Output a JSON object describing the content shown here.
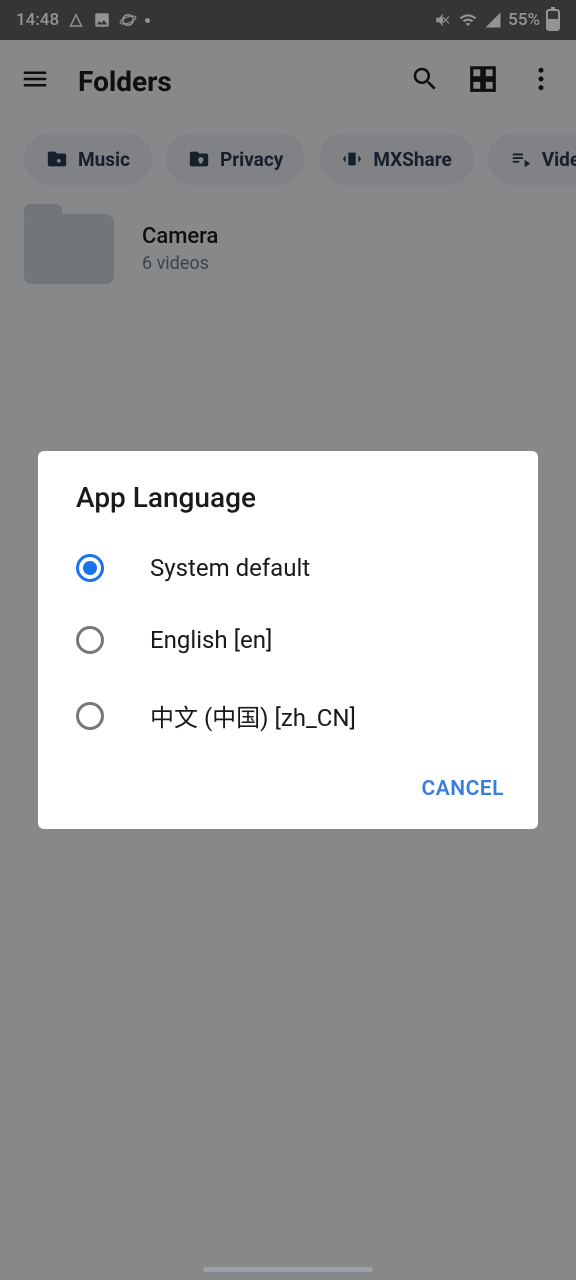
{
  "status": {
    "time": "14:48",
    "battery_pct": "55%"
  },
  "appbar": {
    "title": "Folders"
  },
  "chips": [
    {
      "label": "Music"
    },
    {
      "label": "Privacy"
    },
    {
      "label": "MXShare"
    },
    {
      "label": "Video"
    }
  ],
  "folder": {
    "name": "Camera",
    "sub": "6 videos"
  },
  "dialog": {
    "title": "App Language",
    "options": [
      {
        "label": "System default",
        "selected": true
      },
      {
        "label": "English [en]",
        "selected": false
      },
      {
        "label": "中文 (中国) [zh_CN]",
        "selected": false
      }
    ],
    "cancel": "CANCEL"
  }
}
